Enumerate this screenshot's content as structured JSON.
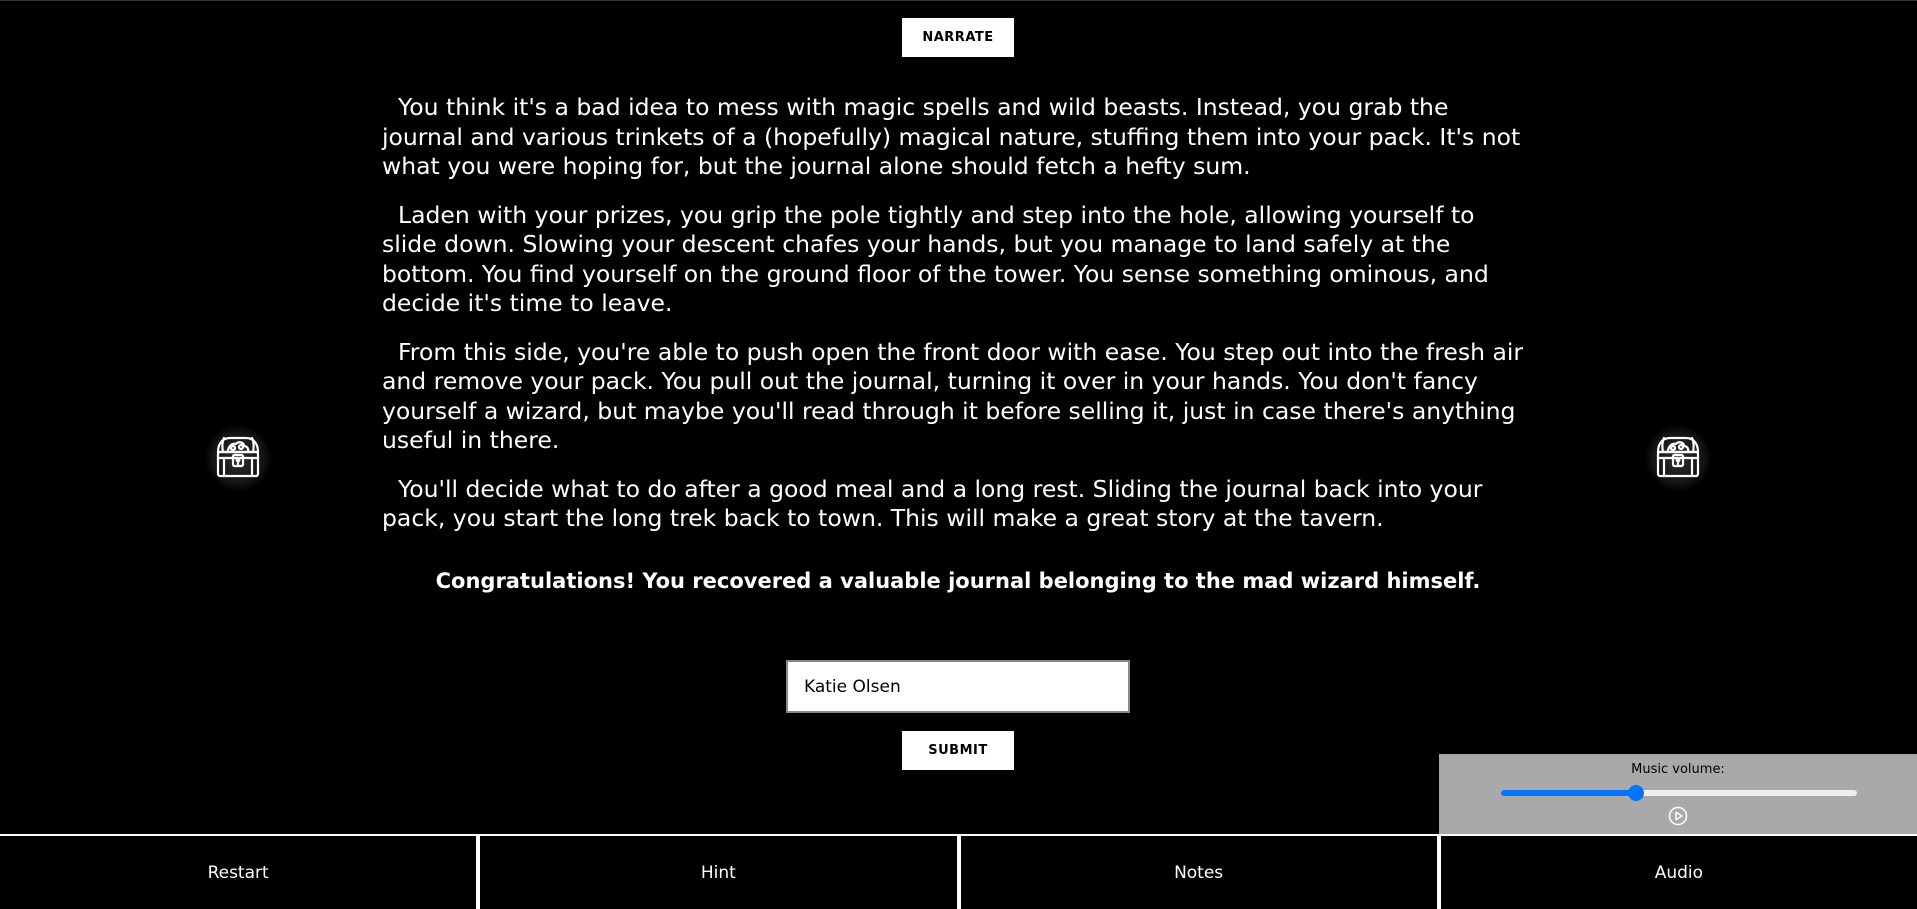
{
  "narrate_label": "NARRATE",
  "story": {
    "paragraphs": [
      "You think it's a bad idea to mess with magic spells and wild beasts. Instead, you grab the journal and various trinkets of a (hopefully) magical nature, stuffing them into your pack. It's not what you were hoping for, but the journal alone should fetch a hefty sum.",
      "Laden with your prizes, you grip the pole tightly and step into the hole, allowing yourself to slide down. Slowing your descent chafes your hands, but you manage to land safely at the bottom. You find yourself on the ground floor of the tower. You sense something ominous, and decide it's time to leave.",
      "From this side, you're able to push open the front door with ease. You step out into the fresh air and remove your pack. You pull out the journal, turning it over in your hands. You don't fancy yourself a wizard, but maybe you'll read through it before selling it, just in case there's anything useful in there.",
      "You'll decide what to do after a good meal and a long rest. Sliding the journal back into your pack, you start the long trek back to town. This will make a great story at the tavern."
    ],
    "congrats": "Congratulations! You recovered a valuable journal belonging to the mad wizard himself."
  },
  "name_input": {
    "value": "Katie Olsen"
  },
  "submit_label": "SUBMIT",
  "icons": {
    "left": "treasure-chest-icon",
    "right": "treasure-chest-icon"
  },
  "audio_panel": {
    "label": "Music volume:",
    "volume": 0.38,
    "play_icon": "play-circle-icon",
    "accent_color": "#0075ff"
  },
  "bottom_tabs": [
    {
      "label": "Restart"
    },
    {
      "label": "Hint"
    },
    {
      "label": "Notes"
    },
    {
      "label": "Audio"
    }
  ]
}
